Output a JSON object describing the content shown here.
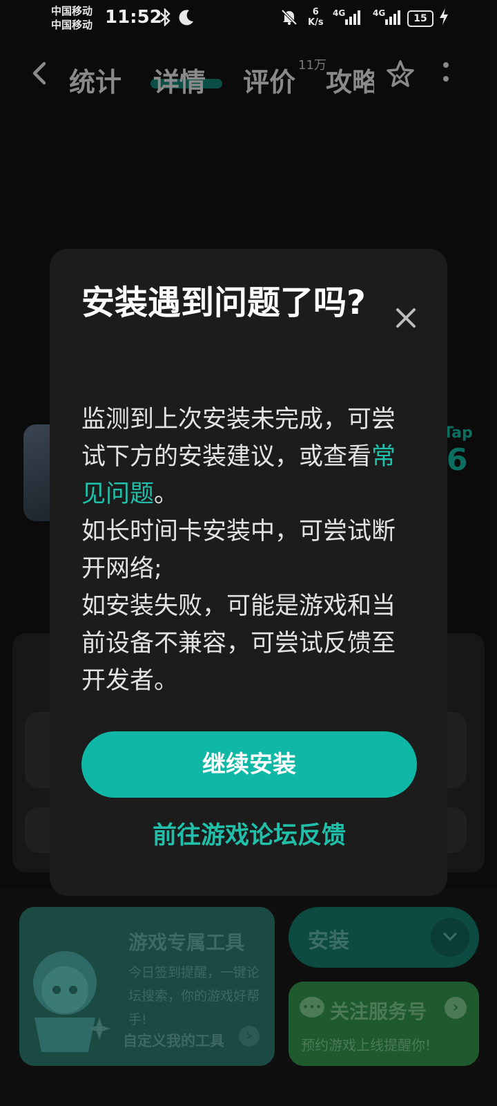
{
  "status_bar": {
    "carrier_1": "中国移动",
    "carrier_2": "中国移动",
    "time": "11:52",
    "net_speed_value": "6",
    "net_speed_unit": "K/s",
    "sim1_tech": "4G",
    "sim2_tech": "4G",
    "battery": "15"
  },
  "nav": {
    "tabs": [
      {
        "label": "统计"
      },
      {
        "label": "详情"
      },
      {
        "label": "评价"
      },
      {
        "label": "攻略"
      }
    ],
    "reviews_badge": "11万"
  },
  "background": {
    "rating_brand": "Tap",
    "rating_score": ".6"
  },
  "dialog": {
    "title": "安装遇到问题了吗?",
    "body_part1": "监测到上次安装未完成，可尝试下方的安装建议，或查看",
    "body_link": "常见问题",
    "body_part2": "。",
    "body_line2": "如长时间卡安装中，可尝试断开网络;",
    "body_line3": "如安装失败，可能是游戏和当前设备不兼容，可尝试反馈至开发者。",
    "primary_button": "继续安装",
    "secondary_button": "前往游戏论坛反馈"
  },
  "bottom": {
    "tool_title": "游戏专属工具",
    "tool_desc": "今日签到提醒，一键论坛搜索，你的游戏好帮手!",
    "tool_link": "自定义我的工具",
    "install_label": "安装",
    "follow_title": "关注服务号",
    "follow_sub": "预约游戏上线提醒你!"
  },
  "colors": {
    "accent": "#0fb8a6",
    "link": "#1fbfa9",
    "dialog_bg": "#1c1c1c"
  }
}
